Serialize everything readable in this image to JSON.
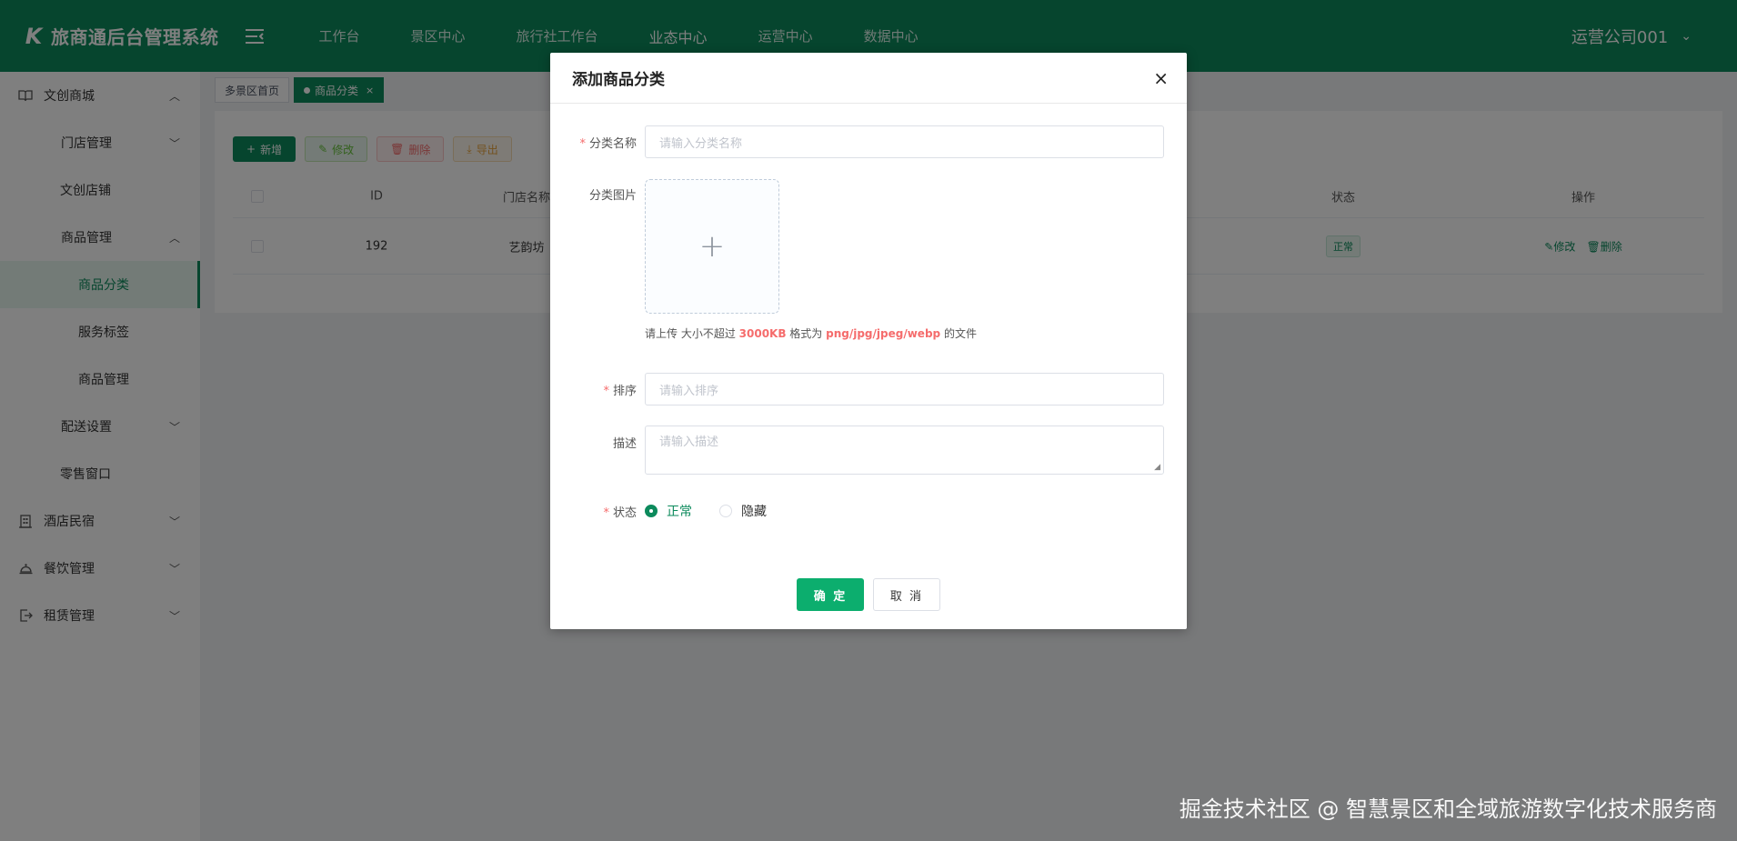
{
  "header": {
    "logo_mark": "K",
    "app_title": "旅商通后台管理系统",
    "nav": [
      "工作台",
      "景区中心",
      "旅行社工作台",
      "业态中心",
      "运营中心",
      "数据中心"
    ],
    "active_nav": "业态中心",
    "user": "运营公司001"
  },
  "sidebar": {
    "items": [
      {
        "label": "文创商城"
      },
      {
        "label": "门店管理"
      },
      {
        "label": "文创店铺"
      },
      {
        "label": "商品管理"
      },
      {
        "label": "商品分类"
      },
      {
        "label": "服务标签"
      },
      {
        "label": "商品管理"
      },
      {
        "label": "配送设置"
      },
      {
        "label": "零售窗口"
      },
      {
        "label": "酒店民宿"
      },
      {
        "label": "餐饮管理"
      },
      {
        "label": "租赁管理"
      }
    ]
  },
  "tabs": [
    {
      "label": "多景区首页"
    },
    {
      "label": "商品分类",
      "close": "×"
    }
  ],
  "toolbar": {
    "add": "新增",
    "edit": "修改",
    "delete": "删除",
    "export": "导出"
  },
  "table": {
    "columns": [
      "ID",
      "门店名称",
      "状态",
      "操作"
    ],
    "rows": [
      {
        "id": "192",
        "store": "艺韵坊",
        "status": "正常",
        "op_edit": "修改",
        "op_delete": "删除"
      }
    ]
  },
  "dialog": {
    "title": "添加商品分类",
    "close": "×",
    "name_label": "分类名称",
    "name_placeholder": "请输入分类名称",
    "image_label": "分类图片",
    "tip_prefix": "请上传 大小不超过 ",
    "tip_size": "3000KB",
    "tip_mid": " 格式为 ",
    "tip_formats": "png/jpg/jpeg/webp",
    "tip_suffix": " 的文件",
    "sort_label": "排序",
    "sort_placeholder": "请输入排序",
    "desc_label": "描述",
    "desc_placeholder": "请输入描述",
    "status_label": "状态",
    "status_options": [
      "正常",
      "隐藏"
    ],
    "status_selected": "正常",
    "ok": "确 定",
    "cancel": "取 消"
  },
  "watermark": "掘金技术社区 @ 智慧景区和全域旅游数字化技术服务商"
}
